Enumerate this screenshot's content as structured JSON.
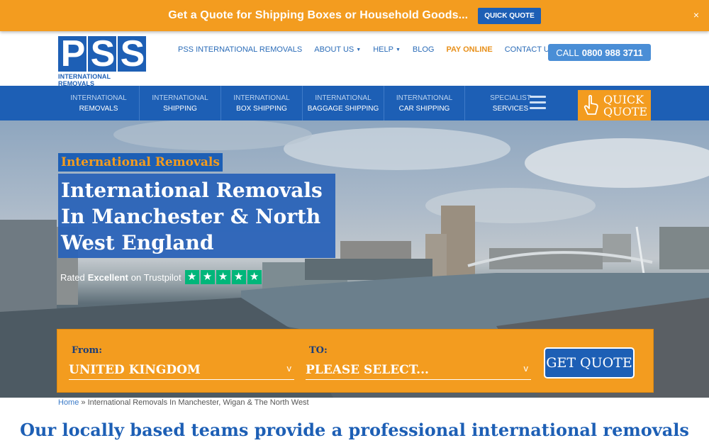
{
  "promo": {
    "text": "Get a Quote for Shipping Boxes or Household Goods...",
    "button": "QUICK QUOTE",
    "close": "×"
  },
  "logo": {
    "letters": [
      "P",
      "S",
      "S"
    ],
    "subtitle": "INTERNATIONAL REMOVALS"
  },
  "top_nav": [
    {
      "label": "PSS INTERNATIONAL REMOVALS"
    },
    {
      "label": "ABOUT US",
      "dropdown": true
    },
    {
      "label": "HELP",
      "dropdown": true
    },
    {
      "label": "BLOG"
    },
    {
      "label": "PAY ONLINE",
      "highlight": "#e8901a"
    },
    {
      "label": "CONTACT US"
    }
  ],
  "call": {
    "prefix": "CALL",
    "number": "0800 988 3711"
  },
  "main_nav": [
    {
      "line1": "INTERNATIONAL",
      "line2": "REMOVALS"
    },
    {
      "line1": "INTERNATIONAL",
      "line2": "SHIPPING"
    },
    {
      "line1": "INTERNATIONAL",
      "line2": "BOX SHIPPING"
    },
    {
      "line1": "INTERNATIONAL",
      "line2": "BAGGAGE SHIPPING"
    },
    {
      "line1": "INTERNATIONAL",
      "line2": "CAR SHIPPING"
    },
    {
      "line1": "SPECIALIST",
      "line2": "SERVICES"
    }
  ],
  "quick_quote": {
    "line1": "QUICK",
    "line2": "QUOTE"
  },
  "hero": {
    "tag": "International Removals",
    "heading": "International Removals In Manchester & North West England",
    "rating": {
      "prefix": "Rated",
      "word": "Excellent",
      "suffix": "on Trustpilot",
      "stars": 5
    }
  },
  "quote_form": {
    "from_label": "From:",
    "from_value": "UNITED KINGDOM",
    "to_label": "TO:",
    "to_value": "PLEASE SELECT...",
    "chevron": "v",
    "button": "GET QUOTE"
  },
  "breadcrumb": {
    "home": "Home",
    "separator": "»",
    "current": "International Removals In Manchester, Wigan & The North West"
  },
  "intro": "Our locally based teams provide a professional international removals",
  "colors": {
    "brand_blue": "#1d5fb5",
    "accent_orange": "#f39c1f",
    "trustpilot_green": "#00b67a"
  }
}
